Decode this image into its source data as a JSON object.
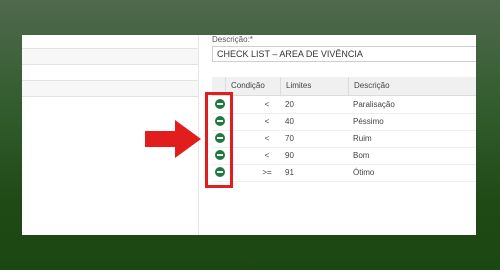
{
  "form": {
    "description_label": "Descrição:*",
    "description_value": "CHECK LIST – AREA DE VIVÊNCIA"
  },
  "grid": {
    "headers": [
      "Condição",
      "Limites",
      "Descrição"
    ],
    "rows": [
      {
        "condition": "<",
        "limit": "20",
        "description": "Paralisação"
      },
      {
        "condition": "<",
        "limit": "40",
        "description": "Péssimo"
      },
      {
        "condition": "<",
        "limit": "70",
        "description": "Ruim"
      },
      {
        "condition": "<",
        "limit": "90",
        "description": "Bom"
      },
      {
        "condition": ">=",
        "limit": "91",
        "description": "Ótimo"
      }
    ]
  },
  "icons": {
    "row_action": "remove-circle-icon",
    "pointer": "arrow-right-icon"
  },
  "colors": {
    "background_top": "#4f6a4d",
    "background_bottom": "#1b4712",
    "remove_icon": "#1e7a3d",
    "highlight": "#e21d1d"
  }
}
